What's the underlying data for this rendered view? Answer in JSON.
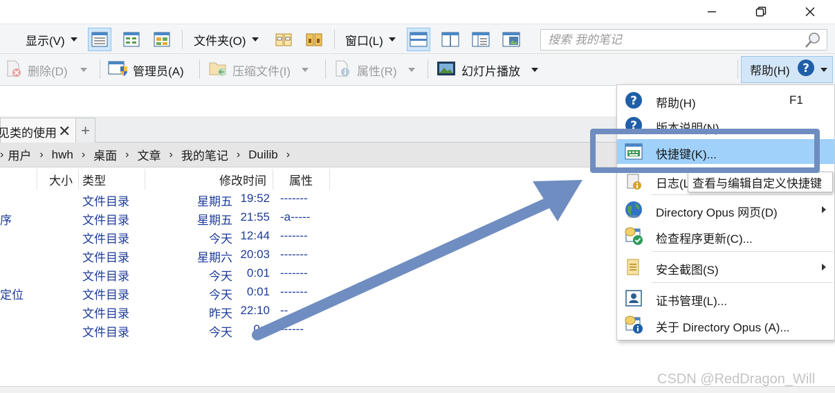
{
  "window": {
    "minimize_icon": "minimize-icon",
    "restore_icon": "restore-icon",
    "close_icon": "close-icon"
  },
  "toolbar1": {
    "display_menu": "显示(V)",
    "folder_menu": "文件夹(O)",
    "window_menu": "窗口(L)",
    "search_placeholder": "搜索 我的笔记"
  },
  "toolbar2": {
    "delete": "删除(D)",
    "admin": "管理员(A)",
    "compress": "压缩文件(I)",
    "properties": "属性(R)",
    "slideshow": "幻灯片播放",
    "help": "帮助(H)"
  },
  "tab": {
    "label": "见类的使用",
    "close": "✕",
    "add": "+"
  },
  "breadcrumb": [
    "用户",
    "hwh",
    "桌面",
    "文章",
    "我的笔记",
    "Duilib"
  ],
  "columns": {
    "size": "大小",
    "type": "类型",
    "modified": "修改时间",
    "attr": "属性"
  },
  "rows": [
    {
      "name": "",
      "type": "文件目录",
      "day": "星期五",
      "time": "19:52",
      "attr": "-------"
    },
    {
      "name": "序",
      "type": "文件目录",
      "day": "星期五",
      "time": "21:55",
      "attr": "-a-----"
    },
    {
      "name": "",
      "type": "文件目录",
      "day": "今天",
      "time": "12:44",
      "attr": "-------"
    },
    {
      "name": "",
      "type": "文件目录",
      "day": "星期六",
      "time": "20:03",
      "attr": "-------"
    },
    {
      "name": "",
      "type": "文件目录",
      "day": "今天",
      "time": "0:01",
      "attr": "-------"
    },
    {
      "name": "定位",
      "type": "文件目录",
      "day": "今天",
      "time": "0:01",
      "attr": "-------"
    },
    {
      "name": "",
      "type": "文件目录",
      "day": "昨天",
      "time": "22:10",
      "attr": "--"
    },
    {
      "name": "",
      "type": "文件目录",
      "day": "今天",
      "time": "0:0",
      "attr": "------"
    }
  ],
  "help_menu": {
    "items": [
      {
        "label": "帮助(H)",
        "shortcut": "F1"
      },
      {
        "label": "版本说明(N)"
      },
      {
        "label": "快捷键(K)..."
      },
      {
        "label": "日志(L)"
      },
      {
        "label": "Directory Opus 网页(D)"
      },
      {
        "label": "检查程序更新(C)..."
      },
      {
        "label": "安全截图(S)"
      },
      {
        "label": "证书管理(L)..."
      },
      {
        "label": "关于 Directory Opus (A)..."
      }
    ],
    "tooltip": "查看与编辑自定义快捷键"
  },
  "watermark": "CSDN @RedDragon_Will",
  "colors": {
    "highlight": "#9fd1fb",
    "annotation": "#6f8dc0",
    "file_text": "#1d3b98"
  }
}
